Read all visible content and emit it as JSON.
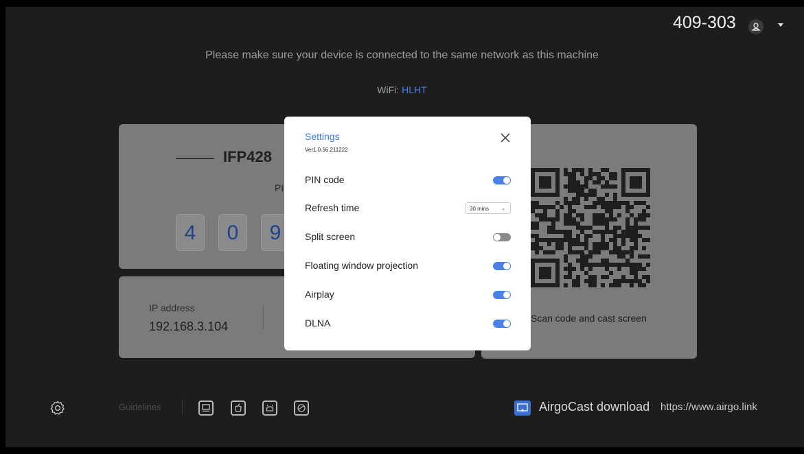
{
  "header": {
    "room_id": "409-303",
    "notice": "Please make sure your device is connected to the same network as this machine",
    "wifi_label": "WiFi:",
    "wifi_name": "HLHT"
  },
  "device_card": {
    "name": "IFP428",
    "pin_label": "PI",
    "pin_digits": [
      "4",
      "0",
      "9"
    ]
  },
  "network_card": {
    "ip_label": "IP address",
    "ip_value": "192.168.3.104"
  },
  "qr_card": {
    "caption": "Scan code and cast screen"
  },
  "settings": {
    "title": "Settings",
    "version": "Ver1.0.56.211222",
    "items": [
      {
        "label": "PIN code",
        "type": "toggle",
        "on": true
      },
      {
        "label": "Refresh time",
        "type": "select",
        "value": "30 mins"
      },
      {
        "label": "Split screen",
        "type": "toggle",
        "on": false
      },
      {
        "label": "Floating window projection",
        "type": "toggle",
        "on": true
      },
      {
        "label": "Airplay",
        "type": "toggle",
        "on": true
      },
      {
        "label": "DLNA",
        "type": "toggle",
        "on": true
      }
    ]
  },
  "footer": {
    "guidelines_label": "Guidelines",
    "platform_icons": [
      "windows-icon",
      "apple-icon",
      "android-icon",
      "chrome-icon"
    ],
    "download_label": "AirgoCast download",
    "download_url": "https://www.airgo.link"
  },
  "colors": {
    "accent": "#4a80e8",
    "wifi": "#4c7ef0",
    "background": "#1d1d1d",
    "card": "#7b7b7b"
  }
}
